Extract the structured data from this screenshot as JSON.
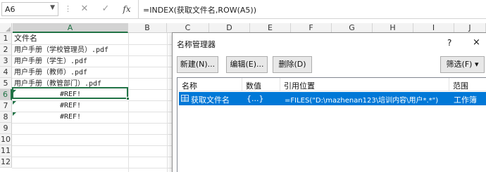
{
  "formula_bar": {
    "name_box": "A6",
    "formula": "=INDEX(获取文件名,ROW(A5))",
    "cancel_glyph": "✕",
    "enter_glyph": "✓",
    "fx_label": "fx"
  },
  "sheet": {
    "columns": [
      "A",
      "B",
      "C",
      "D",
      "E",
      "F",
      "G",
      "H",
      "I",
      "J"
    ],
    "selected_column": "A",
    "rows": [
      "1",
      "2",
      "3",
      "4",
      "5",
      "6",
      "7",
      "8",
      "9",
      "10",
      "11",
      "12"
    ],
    "selected_row": "6",
    "cells": {
      "a1": "文件名",
      "a2": "用户手册（学校管理员）.pdf",
      "a3": "用户手册（学生）.pdf",
      "a4": "用户手册（教师）.pdf",
      "a5": "用户手册（教管部门）.pdf",
      "a6": "#REF!",
      "a7": "#REF!",
      "a8": "#REF!"
    }
  },
  "name_manager": {
    "title": "名称管理器",
    "help": "?",
    "close": "×",
    "buttons": {
      "new": "新建(N)...",
      "edit": "编辑(E)...",
      "delete": "删除(D)",
      "filter": "筛选(F) ▾"
    },
    "headers": [
      "名称",
      "数值",
      "引用位置",
      "范围"
    ],
    "rows": [
      {
        "name": "获取文件名",
        "value": "{...}",
        "refers_to": "=FILES(\"D:\\mazhenan123\\培训内容\\用户*.*\")",
        "scope": "工作簿"
      }
    ]
  },
  "colors": {
    "excel_green": "#217346",
    "selection_blue": "#0078d7"
  }
}
